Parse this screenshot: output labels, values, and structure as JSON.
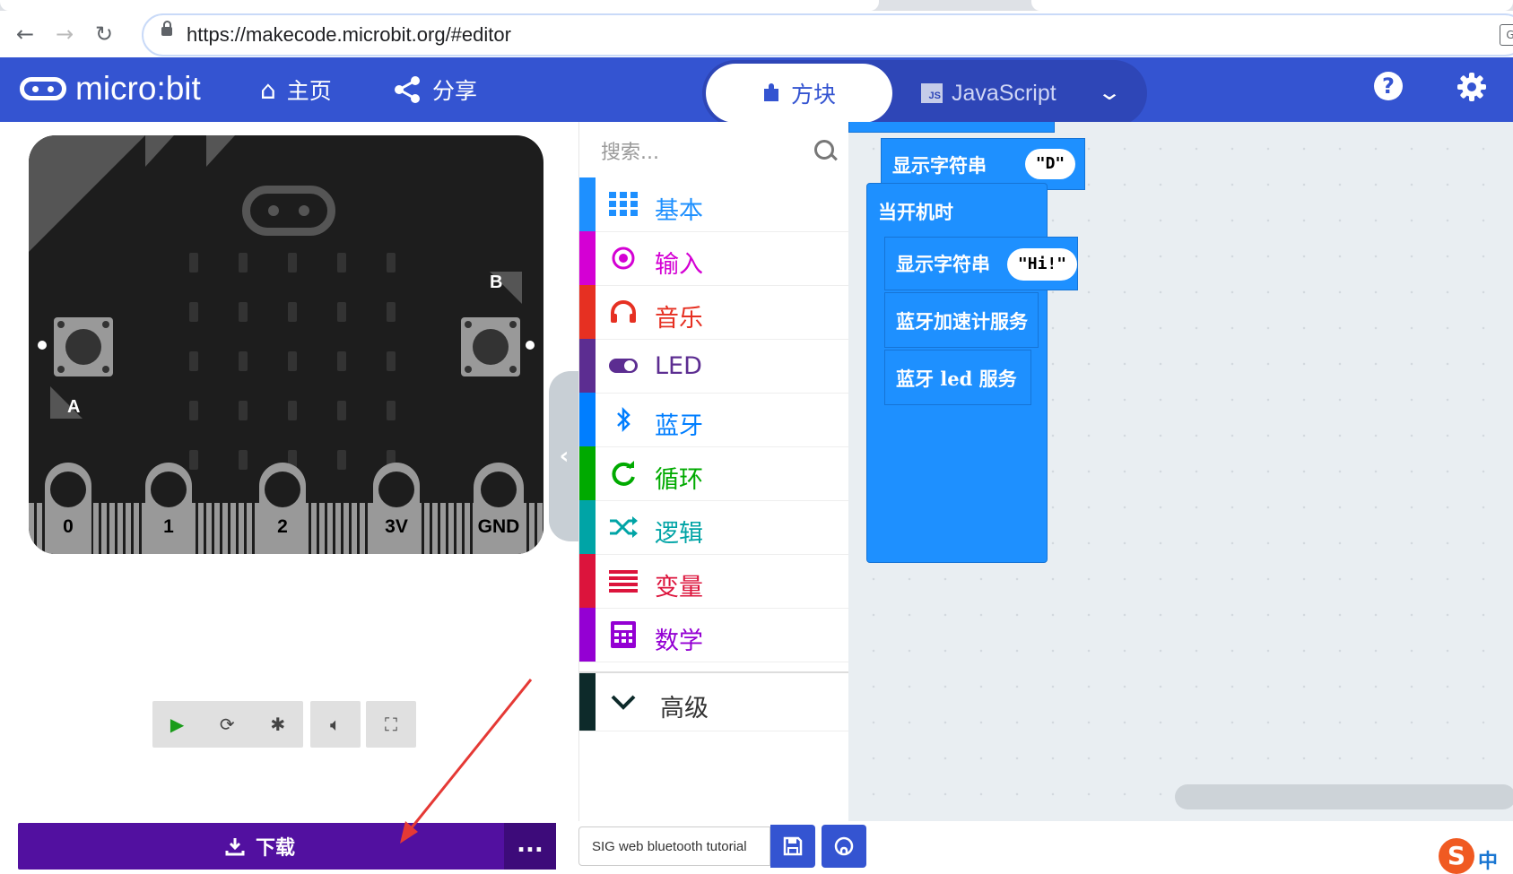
{
  "browser": {
    "url": "https://makecode.microbit.org/#editor"
  },
  "header": {
    "logo_text": "micro:bit",
    "home_label": "主页",
    "share_label": "分享",
    "blocks_label": "方块",
    "javascript_label": "JavaScript",
    "js_badge": "JS",
    "help_icon": "?",
    "colors": {
      "header_bg": "#3454d1",
      "toggle_bg": "#2e46b7"
    }
  },
  "simulator": {
    "button_a_label": "A",
    "button_b_label": "B",
    "pins": [
      "0",
      "1",
      "2",
      "3V",
      "GND"
    ],
    "controls": [
      "play-icon",
      "restart-icon",
      "debug-icon",
      "sound-icon",
      "fullscreen-icon"
    ]
  },
  "toolbox": {
    "search_placeholder": "搜索...",
    "categories": [
      {
        "label": "基本",
        "color": "#1e90ff",
        "icon": "grid-icon"
      },
      {
        "label": "输入",
        "color": "#d400d4",
        "icon": "target-icon"
      },
      {
        "label": "音乐",
        "color": "#e63022",
        "icon": "headphones-icon"
      },
      {
        "label": "LED",
        "color": "#5c2d91",
        "icon": "toggle-icon"
      },
      {
        "label": "蓝牙",
        "color": "#007eff",
        "icon": "bluetooth-icon"
      },
      {
        "label": "循环",
        "color": "#00aa00",
        "icon": "loop-icon"
      },
      {
        "label": "逻辑",
        "color": "#00a4a6",
        "icon": "shuffle-icon"
      },
      {
        "label": "变量",
        "color": "#dc143c",
        "icon": "lines-icon"
      },
      {
        "label": "数学",
        "color": "#9400d3",
        "icon": "calculator-icon"
      }
    ],
    "advanced_label": "高级"
  },
  "workspace": {
    "blocks": {
      "show_string_1": "显示字符串",
      "show_string_1_value": "\"D\"",
      "on_start": "当开机时",
      "show_string_2": "显示字符串",
      "show_string_2_value": "\"Hi!\"",
      "bt_accel": "蓝牙加速计服务",
      "bt_led": "蓝牙 led 服务"
    }
  },
  "footer": {
    "download_label": "下载",
    "more_label": "...",
    "project_name": "SIG web bluetooth tutorial"
  },
  "ime": {
    "logo": "S",
    "mode": "中"
  }
}
